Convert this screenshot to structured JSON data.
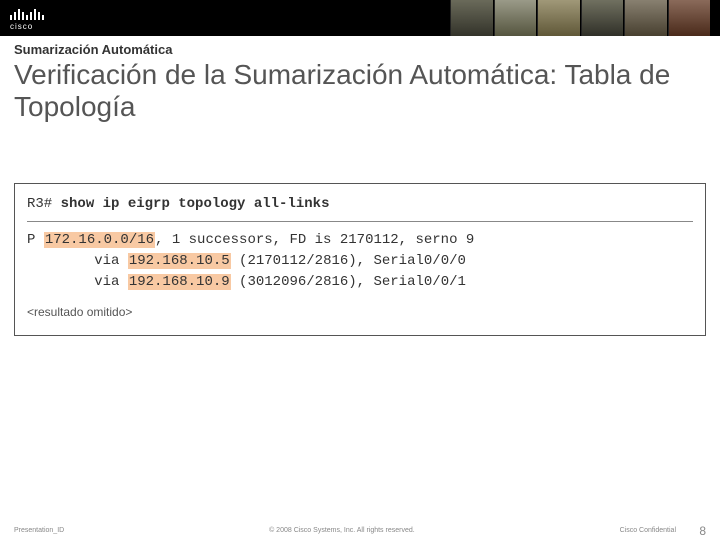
{
  "brand": {
    "name": "cisco"
  },
  "header": {
    "section_label": "Sumarización Automática",
    "title": "Verificación de la Sumarización Automática: Tabla de Topología"
  },
  "terminal": {
    "prompt": "R3#",
    "command": "show ip eigrp topology all-links",
    "line1_prefix": "P ",
    "line1_hl": "172.16.0.0/16",
    "line1_rest": ", 1 successors, FD is 2170112, serno 9",
    "line2_pre": "        via ",
    "line2_hl": "192.168.10.5",
    "line2_rest": " (2170112/2816), Serial0/0/0",
    "line3_pre": "        via ",
    "line3_hl": "192.168.10.9",
    "line3_rest": " (3012096/2816), Serial0/0/1",
    "omitted": "<resultado omitido>"
  },
  "footer": {
    "presentation_id": "Presentation_ID",
    "copyright": "© 2008 Cisco Systems, Inc. All rights reserved.",
    "confidential": "Cisco Confidential",
    "page": "8"
  }
}
